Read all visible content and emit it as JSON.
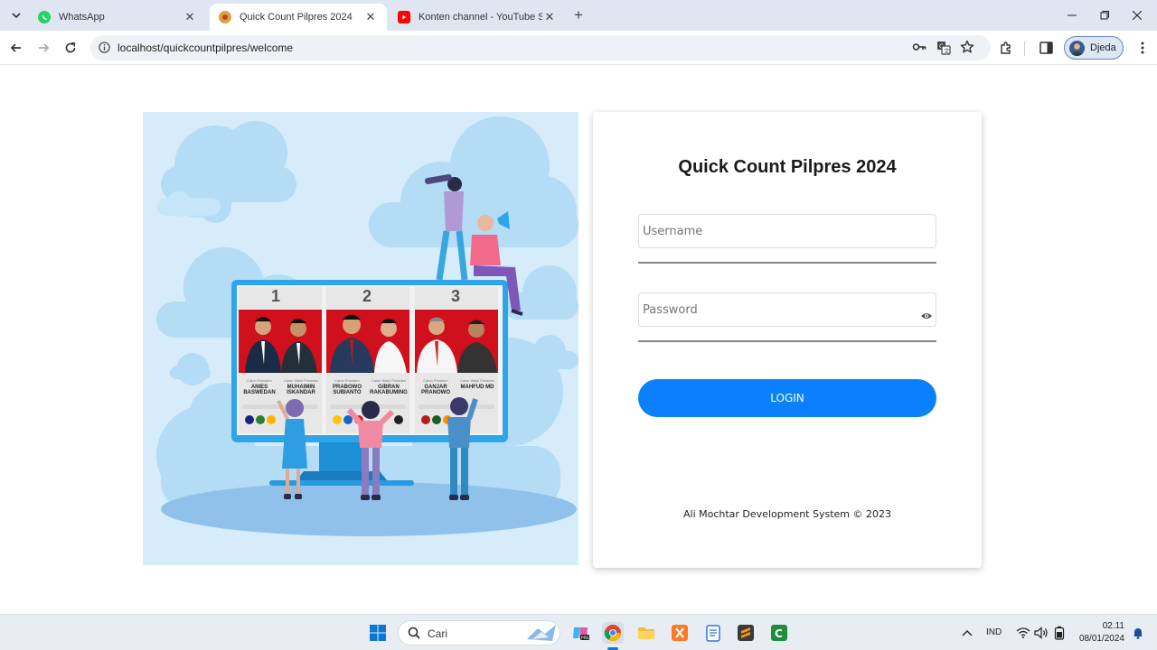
{
  "browser": {
    "tabs": [
      {
        "title": "WhatsApp",
        "favicon": "whatsapp-icon",
        "active": false
      },
      {
        "title": "Quick Count Pilpres 2024",
        "favicon": "site-favicon-icon",
        "active": true
      },
      {
        "title": "Konten channel - YouTube Studio",
        "favicon": "youtube-icon",
        "active": false
      }
    ],
    "url": "localhost/quickcountpilpres/welcome",
    "profile_name": "Djeda"
  },
  "illustration": {
    "candidates": [
      {
        "number": "1",
        "president_role": "Calon Presiden",
        "president": "ANIES BASWEDAN",
        "vice_role": "Calon Wakil Presiden",
        "vice": "MUHAIMIN ISKANDAR"
      },
      {
        "number": "2",
        "president_role": "Calon Presiden",
        "president": "PRABOWO SUBIANTO",
        "vice_role": "Calon Wakil Presiden",
        "vice": "GIBRAN RAKABUMING"
      },
      {
        "number": "3",
        "president_role": "Calon Presiden",
        "president": "GANJAR PRANOWO",
        "vice_role": "Calon Wakil Presiden",
        "vice": "MAHFUD MD"
      }
    ]
  },
  "login": {
    "title": "Quick Count Pilpres 2024",
    "username_placeholder": "Username",
    "password_placeholder": "Password",
    "button_label": "LOGIN",
    "footer": "Ali Mochtar Development System © 2023"
  },
  "taskbar": {
    "search_label": "Cari",
    "language": "IND",
    "time": "02.11",
    "date": "08/01/2024"
  },
  "colors": {
    "accent": "#0a80fd",
    "illustration_bg": "#d6ecfa",
    "poster_red": "#d0101c"
  }
}
